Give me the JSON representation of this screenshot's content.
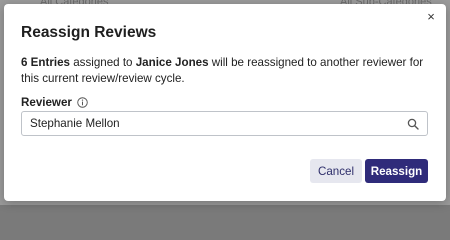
{
  "background": {
    "left_text": "All Categories",
    "right_text": "All Sub-Categories"
  },
  "modal": {
    "title": "Reassign Reviews",
    "close_symbol": "×",
    "message": {
      "count_text": "6 Entries",
      "mid_text": " assigned to ",
      "reviewer_name": "Janice Jones",
      "tail_text": " will be reassigned to another reviewer for this current review/review cycle."
    },
    "reviewer_label": "Reviewer",
    "reviewer_value": "Stephanie Mellon",
    "info_icon": "info-circle-icon",
    "search_icon": "search-icon",
    "cancel_label": "Cancel",
    "reassign_label": "Reassign"
  },
  "colors": {
    "primary": "#2f2b7a",
    "secondary_bg": "#e6e7ef",
    "overlay": "rgba(40,40,40,0.35)"
  }
}
